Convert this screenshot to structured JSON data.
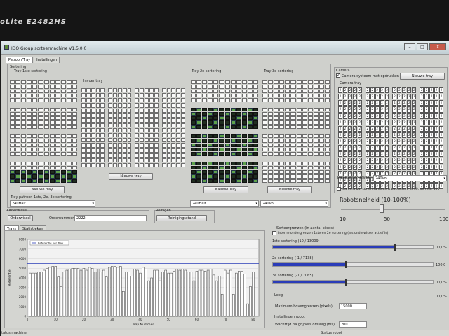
{
  "monitor": {
    "brand": "oLite E2482HS"
  },
  "window": {
    "title": "IDO Group sorteermachine V1.5.0.0",
    "min": "–",
    "max": "□",
    "close": "X"
  },
  "tabs": [
    {
      "label": "Patroon/Tray"
    },
    {
      "label": "Instellingen"
    }
  ],
  "sortering": {
    "group_label": "Sortering",
    "tray1_label": "Tray 1ste sortering",
    "invoer_label": "Invoer tray",
    "tray2_label": "Tray 2e sortering",
    "tray3_label": "Tray 3e sortering",
    "nieuwe_tray": "Nieuwe tray",
    "nieuwe_tray_cap": "Nieuwe Tray",
    "patroon_label": "Tray patroon 1ste, 2e, 3e sortering",
    "combo1": "240Half",
    "combo2": "240Half",
    "combo3": "240Vol"
  },
  "camera": {
    "group_label": "Camera",
    "checkbox_label": "Camera systeem met opdrukken",
    "checked": true,
    "nieuwe_tray": "Nieuwe tray",
    "tray_label": "Camera tray",
    "cell_text": "2",
    "patroon_label": "Tray patroon invoer",
    "patroon_value": "240Vol",
    "camera_uit_label": "Camera uit, sortering volgens patroon=0 of 50, de rest: 100",
    "camera_uit_checked": false
  },
  "robot": {
    "speed_label": "Robotsnelheid (10-100%)",
    "min": "10",
    "mid": "50",
    "max": "100",
    "value": 45
  },
  "orderwissel": {
    "group": "Orderwissel",
    "button": "Orderwissel",
    "order_label": "Ordernummer",
    "order_value": "2222"
  },
  "reinigen": {
    "group": "Reinigen",
    "button": "Reinigingsstand"
  },
  "lower_tabs": [
    {
      "label": "Trays"
    },
    {
      "label": "Statistieken"
    }
  ],
  "sorteergrenzen": {
    "title": "Sorteergrenzen (in aantal pixels)",
    "interne_label": "Interne ondergrenzen 1ste en 2e sortering (als onderwissel actief is)",
    "rows": [
      {
        "label": "1ste sortering (10 / 13009)",
        "fill": 0.76,
        "mark": 0.76,
        "value": "00,0%"
      },
      {
        "label": "2e sortering (-1 / 7138)",
        "fill": 0.45,
        "mark": 0.45,
        "value": "100,0"
      },
      {
        "label": "3e sortering (-1 / 7065)",
        "fill": 0.45,
        "mark": 0.45,
        "value": "00,0%"
      }
    ],
    "leeg_label": "Leeg",
    "leeg_value": "00,0%",
    "max_label": "Maximum bovengrenzen (pixels)",
    "max_value": "15000",
    "robot_label": "Instellingen robot",
    "wacht_label": "Wachttijd na grijpers omlaag (ms)",
    "wacht_value": "200"
  },
  "status": {
    "left": "tatus machine",
    "right": "Status robot"
  },
  "chart_data": {
    "type": "bar",
    "legend": "Referentie per Tray",
    "xlabel": "Tray Nummer",
    "ylabel": "Referentie",
    "xlim": [
      0,
      82
    ],
    "ylim": [
      0,
      8000
    ],
    "yticks": [
      0,
      1000,
      2000,
      3000,
      4000,
      5000,
      6000,
      7000,
      8000
    ],
    "xticks": [
      0,
      10,
      20,
      30,
      40,
      50,
      60,
      70,
      80
    ],
    "reference_line": 5500,
    "x": [
      1,
      2,
      3,
      4,
      5,
      6,
      7,
      8,
      9,
      10,
      11,
      12,
      13,
      14,
      15,
      16,
      17,
      18,
      19,
      20,
      21,
      22,
      23,
      24,
      25,
      26,
      27,
      28,
      29,
      30,
      31,
      32,
      33,
      34,
      35,
      36,
      37,
      38,
      39,
      40,
      41,
      42,
      43,
      44,
      45,
      46,
      47,
      48,
      49,
      50,
      51,
      52,
      53,
      54,
      55,
      56,
      57,
      58,
      59,
      60,
      61,
      62,
      63,
      64,
      65,
      66,
      67,
      68,
      69,
      70,
      71,
      72,
      73,
      74,
      75,
      76,
      77,
      78,
      79,
      80
    ],
    "values": [
      4500,
      4500,
      4500,
      4600,
      4600,
      4800,
      5000,
      5100,
      5200,
      5200,
      4100,
      3100,
      4600,
      4800,
      4900,
      5000,
      5000,
      5000,
      4800,
      5000,
      4800,
      5100,
      5000,
      4600,
      4900,
      4600,
      4800,
      4100,
      5100,
      5200,
      5200,
      5100,
      5200,
      2600,
      4600,
      4600,
      4200,
      4900,
      4800,
      4500,
      5100,
      4900,
      3700,
      4000,
      4800,
      4800,
      3700,
      4600,
      4800,
      4500,
      4500,
      4700,
      4900,
      4800,
      4900,
      4800,
      4600,
      4600,
      3700,
      4700,
      4800,
      4800,
      4700,
      4800,
      4900,
      4300,
      3700,
      4200,
      2300,
      4800,
      4500,
      4800,
      2300,
      4500,
      4700,
      4700,
      4400,
      1300,
      3100,
      4600
    ]
  }
}
